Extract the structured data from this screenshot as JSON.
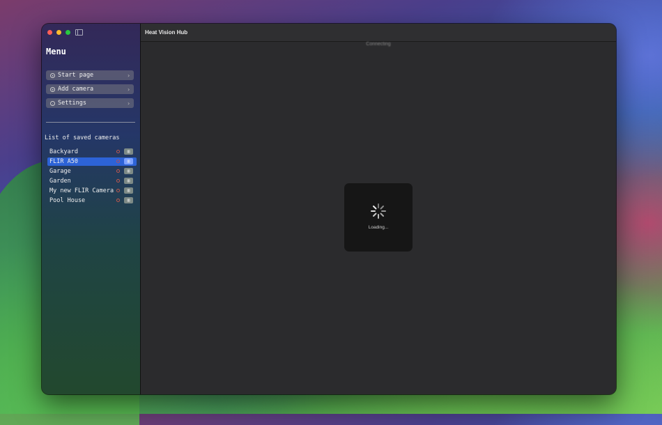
{
  "window": {
    "title": "Heat Vision Hub"
  },
  "sidebar": {
    "menu_title": "Menu",
    "nav": [
      {
        "label": "Start page",
        "icon": "home-icon"
      },
      {
        "label": "Add camera",
        "icon": "plus-circle-icon"
      },
      {
        "label": "Settings",
        "icon": "gear-icon"
      }
    ],
    "list_title": "List of saved cameras",
    "cameras": [
      {
        "name": "Backyard",
        "selected": false
      },
      {
        "name": "FLIR A50",
        "selected": true
      },
      {
        "name": "Garage",
        "selected": false
      },
      {
        "name": "Garden",
        "selected": false
      },
      {
        "name": "My new FLIR Camera",
        "selected": false
      },
      {
        "name": "Pool House",
        "selected": false
      }
    ]
  },
  "main": {
    "status": "Connecting",
    "loading_label": "Loading..."
  },
  "colors": {
    "selected": "#2d63d7",
    "accent_delete": "#7ea3ff"
  }
}
